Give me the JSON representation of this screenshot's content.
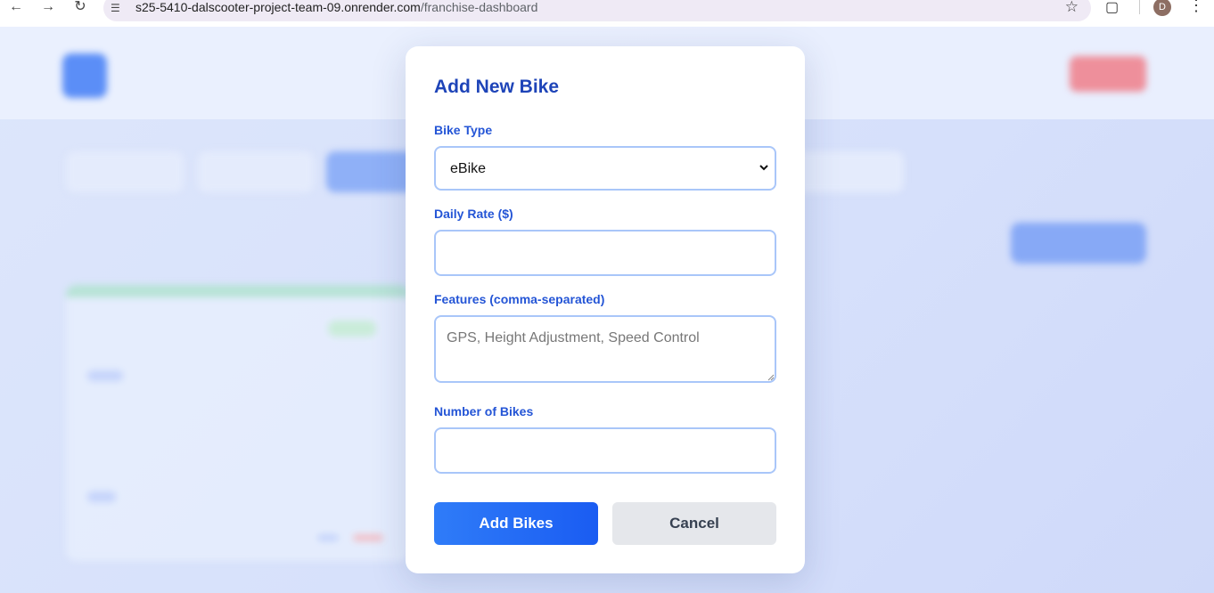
{
  "browser": {
    "url_host": "s25-5410-dalscooter-project-team-09.onrender.com",
    "url_path": "/franchise-dashboard",
    "avatar_letter": "D",
    "icons": [
      "back-icon",
      "forward-icon",
      "reload-icon",
      "site-info-icon",
      "star-icon",
      "extensions-icon",
      "menu-icon"
    ]
  },
  "modal": {
    "title": "Add New Bike",
    "bike_type_label": "Bike Type",
    "bike_type_value": "eBike",
    "daily_rate_label": "Daily Rate ($)",
    "daily_rate_value": "",
    "features_label": "Features (comma-separated)",
    "features_placeholder": "GPS, Height Adjustment, Speed Control",
    "num_bikes_label": "Number of Bikes",
    "num_bikes_value": "",
    "add_button": "Add Bikes",
    "cancel_button": "Cancel"
  },
  "colors": {
    "modal_title": "#1e44b8",
    "label": "#2455d6",
    "input_border": "#a9c6f9",
    "primary_button": "#1a5cf2",
    "cancel_button_bg": "#e5e7eb"
  }
}
